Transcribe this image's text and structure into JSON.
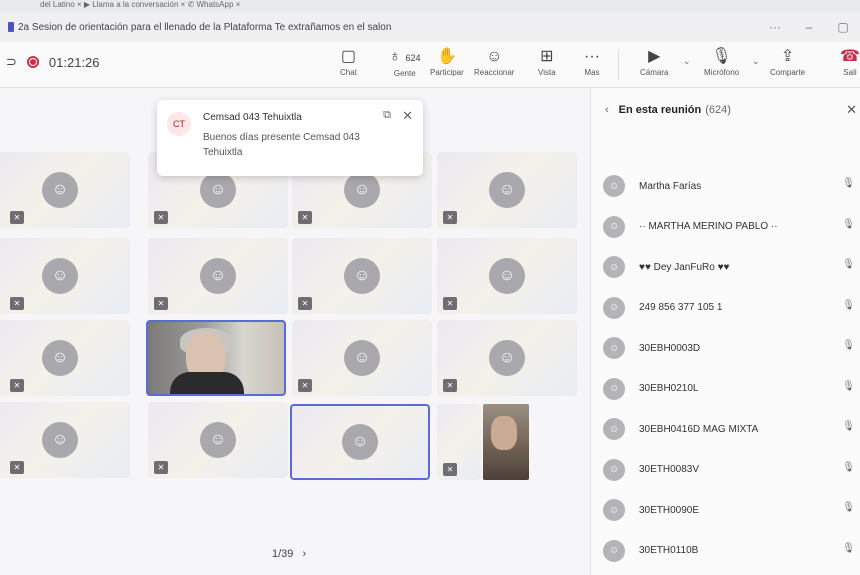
{
  "window": {
    "browser_strip": "del Latino   ×   ▶  Llama a la conversación   ×   ✆  WhatsApp   ×",
    "title": "2a Sesion de orientación para el llenado de la Plataforma Te extrañamos en el salon",
    "controls": [
      "···",
      "–",
      "▢"
    ]
  },
  "toolbar": {
    "timer": "01:21:26",
    "buttons": {
      "chat": "Chat",
      "people": "Gente",
      "people_count": "624",
      "raise": "Participar",
      "react": "Reaccionar",
      "view": "Vista",
      "more": "Mas",
      "camera": "Cámara",
      "mic": "Micrófono",
      "share": "Comparte",
      "leave": "Sali"
    },
    "icons": {
      "chat": "chat-icon",
      "people": "people-icon",
      "raise": "hand-icon",
      "react": "smiley-icon",
      "view": "grid-icon",
      "more": "ellipsis-icon",
      "camera": "camera-off-icon",
      "mic": "mic-off-icon",
      "share": "share-icon",
      "leave": "hangup-icon"
    }
  },
  "notification": {
    "initials": "CT",
    "sender": "Cemsad 043 Tehuixtla",
    "message": "Buenos días presente Cemsad 043 Tehuixtla"
  },
  "stage": {
    "pager": "1/39",
    "tile_count": 16
  },
  "panel": {
    "title": "En esta reunión",
    "count": "(624)",
    "participants": [
      "Martha Farías",
      "·· MARTHA MERINO PABLO ··",
      "♥♥ Dey JanFuRo ♥♥",
      "249 856 377 105 1",
      "30EBH0003D",
      "30EBH0210L",
      "30EBH0416D MAG MIXTA",
      "30ETH0083V",
      "30ETH0090E",
      "30ETH0110B"
    ]
  },
  "colors": {
    "accent": "#5b6bd5",
    "record": "#c4314b",
    "avatar": "#a9a9ad"
  }
}
